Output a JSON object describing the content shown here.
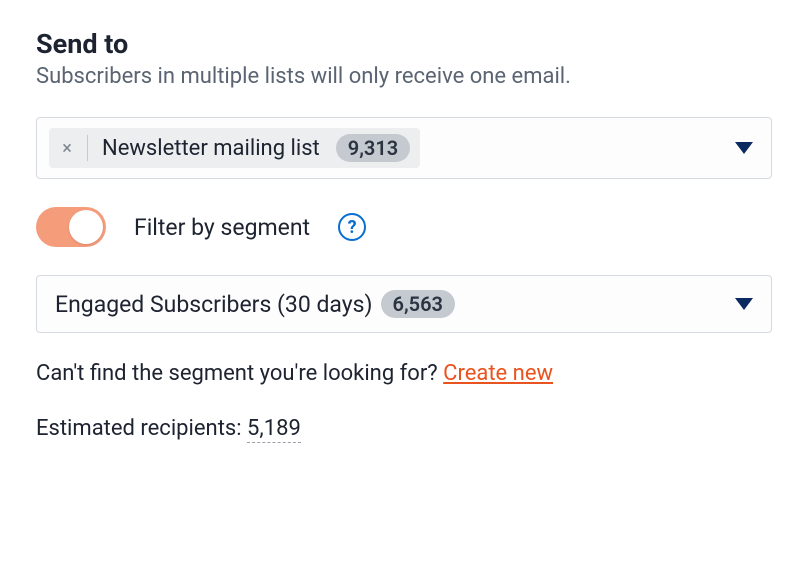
{
  "heading": "Send to",
  "subheading": "Subscribers in multiple lists will only receive one email.",
  "list_select": {
    "chip_label": "Newsletter mailing list",
    "chip_count": "9,313"
  },
  "filter": {
    "toggle_on": true,
    "label": "Filter by segment"
  },
  "segment_select": {
    "label": "Engaged Subscribers (30 days)",
    "count": "6,563"
  },
  "hint": {
    "text": "Can't find the segment you're looking for? ",
    "link_label": "Create new"
  },
  "estimate": {
    "label": "Estimated recipients: ",
    "count": "5,189"
  }
}
